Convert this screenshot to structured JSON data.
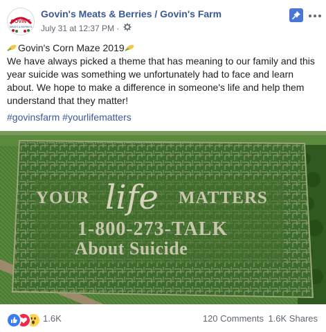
{
  "header": {
    "page_name": "Govin's Meats & Berries / Govin's Farm",
    "timestamp": "July 31 at 12:37 PM",
    "separator": "·",
    "avatar_text": "GOVIN'S",
    "avatar_subtext": "MEATS & BERRIES",
    "icons": [
      "globe-gear-icon",
      "pin-icon",
      "more-options-icon"
    ]
  },
  "post": {
    "title": "Govin's Corn Maze 2019",
    "body": "We have always picked a theme that has meaning to our family and this year suicide was something we unfortunately had to face and learn about. We hope to make a difference in someone's life and help them understand that they matter!",
    "hashtags": [
      "#govinsfarm",
      "#yourlifematters"
    ],
    "emoji": "corn-icon"
  },
  "photo": {
    "maze_line1_a": "YOUR",
    "maze_line1_b": "life",
    "maze_line1_c": "MATTERS",
    "maze_line2": "1-800-273-TALK",
    "maze_line3": "About Suicide"
  },
  "footer": {
    "reactions": [
      "like-icon",
      "love-icon",
      "wow-icon"
    ],
    "reaction_count": "1.6K",
    "comments": "120 Comments",
    "shares": "1.6K Shares"
  },
  "colors": {
    "link_blue": "#385898",
    "pin_blue": "#4a76d6",
    "meta_gray": "#616770",
    "field_green": "#3f6a2a"
  }
}
